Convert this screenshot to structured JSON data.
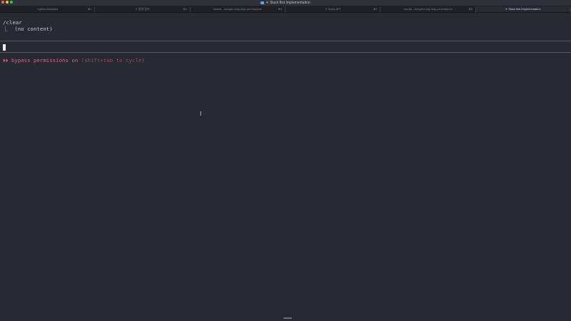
{
  "window": {
    "title": "✳ Slack Bot Implementation"
  },
  "tabs": [
    {
      "label": "~/github/slackbot",
      "shortcut": "⌘1",
      "active": false
    },
    {
      "label": "✳ 명령 정리",
      "shortcut": "⌘2",
      "active": false
    },
    {
      "label": "claude --dangerously-skip-permissions",
      "shortcut": "⌘3",
      "active": false
    },
    {
      "label": "✳ Slack API",
      "shortcut": "⌘4",
      "active": false
    },
    {
      "label": "claude --dangerously-skip-permissions",
      "shortcut": "⌘5",
      "active": false
    },
    {
      "label": "✳ Slack Bot Implementation",
      "shortcut": "",
      "active": true
    }
  ],
  "terminal": {
    "command": "/clear",
    "output": "⎿  (no content)",
    "status_main": "⏵⏵ bypass permissions on",
    "status_hint": " (shift+tab to cycle)"
  },
  "colors": {
    "background": "#282a32",
    "status": "#e0607e",
    "status_hint": "#a0475e"
  }
}
